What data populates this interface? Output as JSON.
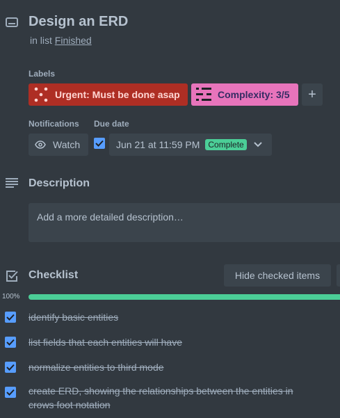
{
  "card": {
    "title": "Design an ERD",
    "in_list_prefix": "in list",
    "list_name": "Finished"
  },
  "labels": {
    "heading": "Labels",
    "items": [
      {
        "text": "Urgent: Must be done asap",
        "color": "#ae2e24"
      },
      {
        "text": "Complexity: 3/5",
        "color": "#e774bb"
      }
    ],
    "add_label": "+"
  },
  "notifications": {
    "heading": "Notifications",
    "watch_label": "Watch"
  },
  "due_date": {
    "heading": "Due date",
    "checked": true,
    "value": "Jun 21 at 11:59 PM",
    "status": "Complete",
    "status_color": "#4bce97"
  },
  "description": {
    "heading": "Description",
    "placeholder": "Add a more detailed description…"
  },
  "checklist": {
    "heading": "Checklist",
    "hide_button": "Hide checked items",
    "progress_label": "100%",
    "progress": 1.0,
    "items": [
      {
        "text": "identify basic entities",
        "checked": true
      },
      {
        "text": "list fields that each entities will have",
        "checked": true
      },
      {
        "text": "normalize entities to third mode",
        "checked": true
      },
      {
        "text": "create ERD, showing the relationships between the entities in crows foot notation",
        "checked": true
      }
    ]
  }
}
